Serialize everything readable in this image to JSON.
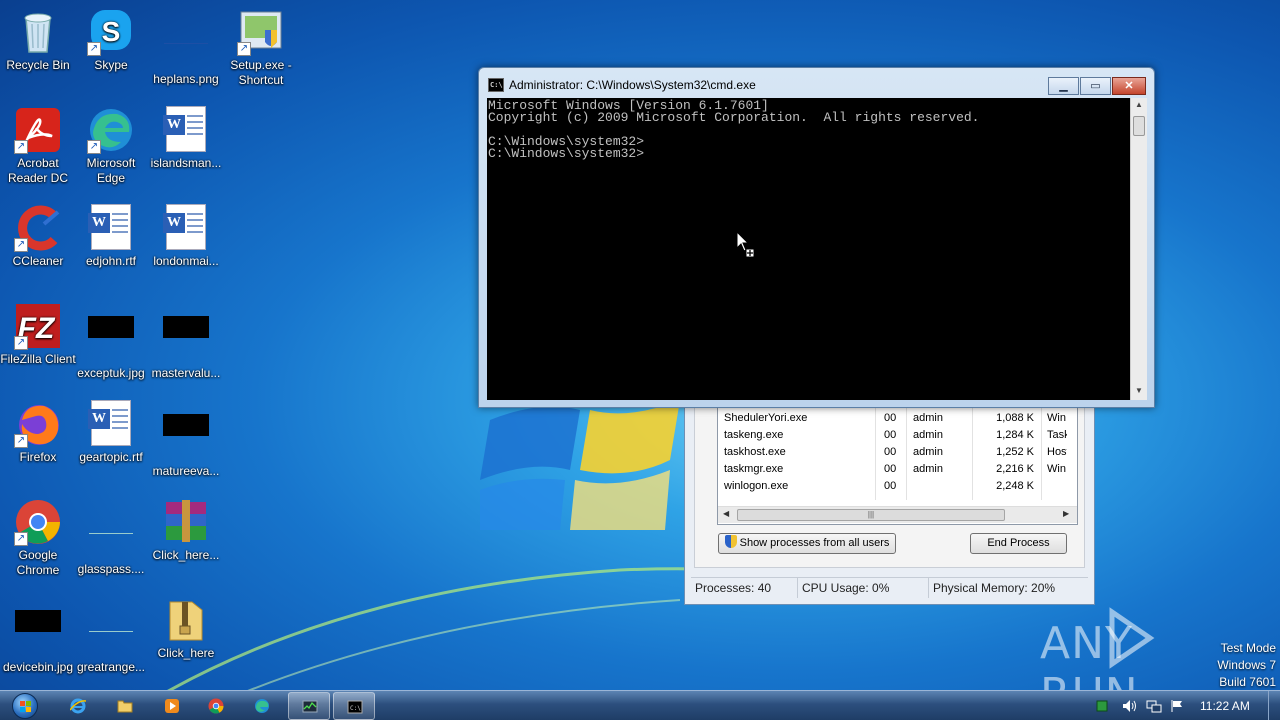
{
  "desktop_icons": [
    {
      "label": "Recycle Bin",
      "icon": "recycle-bin-icon"
    },
    {
      "label": "Skype",
      "icon": "skype-icon"
    },
    {
      "label": "heplans.png",
      "icon": "image-file-icon"
    },
    {
      "label": "Setup.exe - Shortcut",
      "icon": "setup-shortcut-icon"
    },
    {
      "label": "Acrobat Reader DC",
      "icon": "acrobat-reader-icon"
    },
    {
      "label": "Microsoft Edge",
      "icon": "edge-icon"
    },
    {
      "label": "islandsman...",
      "icon": "word-doc-icon"
    },
    {
      "label": "CCleaner",
      "icon": "ccleaner-icon"
    },
    {
      "label": "edjohn.rtf",
      "icon": "word-doc-icon"
    },
    {
      "label": "londonmai...",
      "icon": "word-doc-icon"
    },
    {
      "label": "FileZilla Client",
      "icon": "filezilla-icon"
    },
    {
      "label": "exceptuk.jpg",
      "icon": "image-file-icon"
    },
    {
      "label": "mastervalu...",
      "icon": "image-file-icon"
    },
    {
      "label": "Firefox",
      "icon": "firefox-icon"
    },
    {
      "label": "geartopic.rtf",
      "icon": "word-doc-icon"
    },
    {
      "label": "matureeva...",
      "icon": "image-file-icon"
    },
    {
      "label": "Google Chrome",
      "icon": "chrome-icon"
    },
    {
      "label": "glasspass....",
      "icon": "file-icon"
    },
    {
      "label": "Click_here...",
      "icon": "winrar-icon"
    },
    {
      "label": "devicebin.jpg",
      "icon": "image-file-icon"
    },
    {
      "label": "greatrange...",
      "icon": "file-icon"
    },
    {
      "label": "Click_here",
      "icon": "zip-folder-icon"
    }
  ],
  "cmd_window": {
    "title": "Administrator: C:\\Windows\\System32\\cmd.exe",
    "lines": [
      "Microsoft Windows [Version 6.1.7601]",
      "Copyright (c) 2009 Microsoft Corporation.  All rights reserved.",
      "",
      "C:\\Windows\\system32>",
      "C:\\Windows\\system32>"
    ],
    "buttons": {
      "minimize": "▁",
      "maximize": "▭",
      "close": "✕"
    }
  },
  "task_manager": {
    "processes": [
      {
        "name": "ShedulerYori.exe",
        "cpu": "00",
        "user": "admin",
        "memory": "1,088 K",
        "description": "Win"
      },
      {
        "name": "taskeng.exe",
        "cpu": "00",
        "user": "admin",
        "memory": "1,284 K",
        "description": "Task"
      },
      {
        "name": "taskhost.exe",
        "cpu": "00",
        "user": "admin",
        "memory": "1,252 K",
        "description": "Host"
      },
      {
        "name": "taskmgr.exe",
        "cpu": "00",
        "user": "admin",
        "memory": "2,216 K",
        "description": "Win"
      },
      {
        "name": "winlogon.exe",
        "cpu": "00",
        "user": "",
        "memory": "2,248 K",
        "description": ""
      }
    ],
    "show_all_label": "Show processes from all users",
    "end_process_label": "End Process",
    "status": {
      "processes": "Processes: 40",
      "cpu": "CPU Usage: 0%",
      "memory": "Physical Memory: 20%"
    }
  },
  "watermark": {
    "text": "ANY RUN"
  },
  "test_mode": {
    "line1": "Test Mode",
    "line2": "Windows 7",
    "line3": "Build 7601"
  },
  "taskbar": {
    "items": [
      {
        "name": "internet-explorer",
        "icon": "ie-icon"
      },
      {
        "name": "windows-explorer",
        "icon": "folder-icon"
      },
      {
        "name": "media-player",
        "icon": "media-player-icon"
      },
      {
        "name": "chrome",
        "icon": "chrome-icon"
      },
      {
        "name": "edge",
        "icon": "edge-icon"
      },
      {
        "name": "task-manager",
        "icon": "task-manager-icon",
        "active": true
      },
      {
        "name": "cmd",
        "icon": "cmd-icon",
        "active": true
      }
    ],
    "clock": "11:22 AM"
  }
}
